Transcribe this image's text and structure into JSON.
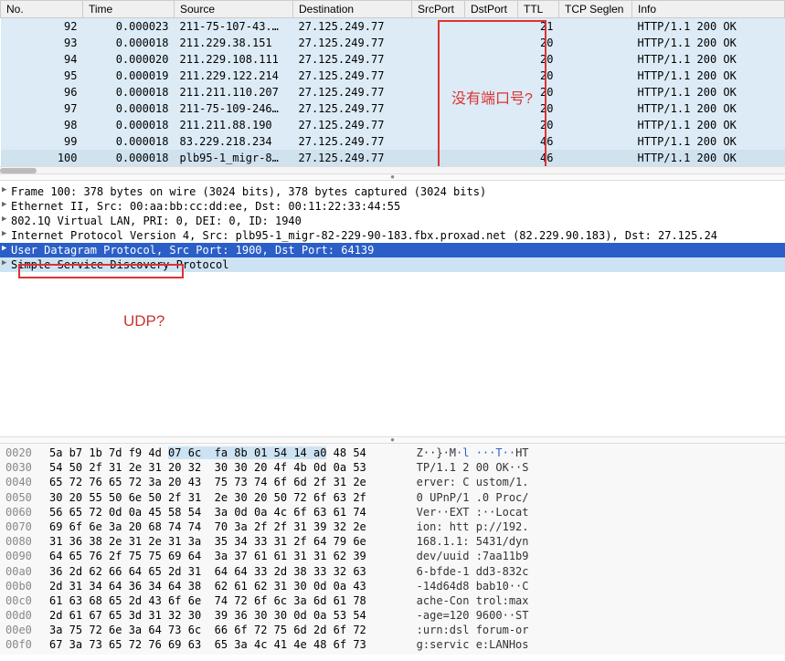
{
  "columns": [
    "No.",
    "Time",
    "Source",
    "Destination",
    "SrcPort",
    "DstPort",
    "TTL",
    "TCP Seglen",
    "Info"
  ],
  "rows": [
    {
      "no": "92",
      "time": "0.000023",
      "src": "211-75-107-43.…",
      "dst": "27.125.249.77",
      "srcport": "",
      "dstport": "",
      "ttl": "21",
      "seglen": "",
      "info": "HTTP/1.1 200 OK"
    },
    {
      "no": "93",
      "time": "0.000018",
      "src": "211.229.38.151",
      "dst": "27.125.249.77",
      "srcport": "",
      "dstport": "",
      "ttl": "20",
      "seglen": "",
      "info": "HTTP/1.1 200 OK"
    },
    {
      "no": "94",
      "time": "0.000020",
      "src": "211.229.108.111",
      "dst": "27.125.249.77",
      "srcport": "",
      "dstport": "",
      "ttl": "20",
      "seglen": "",
      "info": "HTTP/1.1 200 OK"
    },
    {
      "no": "95",
      "time": "0.000019",
      "src": "211.229.122.214",
      "dst": "27.125.249.77",
      "srcport": "",
      "dstport": "",
      "ttl": "20",
      "seglen": "",
      "info": "HTTP/1.1 200 OK"
    },
    {
      "no": "96",
      "time": "0.000018",
      "src": "211.211.110.207",
      "dst": "27.125.249.77",
      "srcport": "",
      "dstport": "",
      "ttl": "20",
      "seglen": "",
      "info": "HTTP/1.1 200 OK"
    },
    {
      "no": "97",
      "time": "0.000018",
      "src": "211-75-109-246…",
      "dst": "27.125.249.77",
      "srcport": "",
      "dstport": "",
      "ttl": "20",
      "seglen": "",
      "info": "HTTP/1.1 200 OK"
    },
    {
      "no": "98",
      "time": "0.000018",
      "src": "211.211.88.190",
      "dst": "27.125.249.77",
      "srcport": "",
      "dstport": "",
      "ttl": "20",
      "seglen": "",
      "info": "HTTP/1.1 200 OK"
    },
    {
      "no": "99",
      "time": "0.000018",
      "src": "83.229.218.234",
      "dst": "27.125.249.77",
      "srcport": "",
      "dstport": "",
      "ttl": "46",
      "seglen": "",
      "info": "HTTP/1.1 200 OK"
    },
    {
      "no": "100",
      "time": "0.000018",
      "src": "plb95-1_migr-8…",
      "dst": "27.125.249.77",
      "srcport": "",
      "dstport": "",
      "ttl": "46",
      "seglen": "",
      "info": "HTTP/1.1 200 OK"
    }
  ],
  "annotations": {
    "box1_text": "没有端口号?",
    "text1": "UDP?"
  },
  "tree": [
    "Frame 100: 378 bytes on wire (3024 bits), 378 bytes captured (3024 bits)",
    "Ethernet II, Src: 00:aa:bb:cc:dd:ee, Dst: 00:11:22:33:44:55",
    "802.1Q Virtual LAN, PRI: 0, DEI: 0, ID: 1940",
    "Internet Protocol Version 4, Src: plb95-1_migr-82-229-90-183.fbx.proxad.net (82.229.90.183), Dst: 27.125.24",
    "User Datagram Protocol, Src Port: 1900, Dst Port: 64139",
    "Simple Service Discovery Protocol"
  ],
  "hex": [
    {
      "off": "0020",
      "bytes": "5a b7 1b 7d f9 4d ",
      "bytes_hl": "07 6c  fa 8b 01 54 14 a0",
      "bytes_end": " 48 54",
      "ascii": "Z··}·M",
      "ascii_hl": "·l ···T··",
      "ascii_end": "HT"
    },
    {
      "off": "0030",
      "bytes": "54 50 2f 31 2e 31 20 32  30 30 20 4f 4b 0d 0a 53",
      "ascii": "TP/1.1 2 00 OK··S"
    },
    {
      "off": "0040",
      "bytes": "65 72 76 65 72 3a 20 43  75 73 74 6f 6d 2f 31 2e",
      "ascii": "erver: C ustom/1."
    },
    {
      "off": "0050",
      "bytes": "30 20 55 50 6e 50 2f 31  2e 30 20 50 72 6f 63 2f",
      "ascii": "0 UPnP/1 .0 Proc/"
    },
    {
      "off": "0060",
      "bytes": "56 65 72 0d 0a 45 58 54  3a 0d 0a 4c 6f 63 61 74",
      "ascii": "Ver··EXT :··Locat"
    },
    {
      "off": "0070",
      "bytes": "69 6f 6e 3a 20 68 74 74  70 3a 2f 2f 31 39 32 2e",
      "ascii": "ion: htt p://192."
    },
    {
      "off": "0080",
      "bytes": "31 36 38 2e 31 2e 31 3a  35 34 33 31 2f 64 79 6e",
      "ascii": "168.1.1: 5431/dyn"
    },
    {
      "off": "0090",
      "bytes": "64 65 76 2f 75 75 69 64  3a 37 61 61 31 31 62 39",
      "ascii": "dev/uuid :7aa11b9"
    },
    {
      "off": "00a0",
      "bytes": "36 2d 62 66 64 65 2d 31  64 64 33 2d 38 33 32 63",
      "ascii": "6-bfde-1 dd3-832c"
    },
    {
      "off": "00b0",
      "bytes": "2d 31 34 64 36 34 64 38  62 61 62 31 30 0d 0a 43",
      "ascii": "-14d64d8 bab10··C"
    },
    {
      "off": "00c0",
      "bytes": "61 63 68 65 2d 43 6f 6e  74 72 6f 6c 3a 6d 61 78",
      "ascii": "ache-Con trol:max"
    },
    {
      "off": "00d0",
      "bytes": "2d 61 67 65 3d 31 32 30  39 36 30 30 0d 0a 53 54",
      "ascii": "-age=120 9600··ST"
    },
    {
      "off": "00e0",
      "bytes": "3a 75 72 6e 3a 64 73 6c  66 6f 72 75 6d 2d 6f 72",
      "ascii": ":urn:dsl forum-or"
    },
    {
      "off": "00f0",
      "bytes": "67 3a 73 65 72 76 69 63  65 3a 4c 41 4e 48 6f 73",
      "ascii": "g:servic e:LANHos"
    }
  ]
}
